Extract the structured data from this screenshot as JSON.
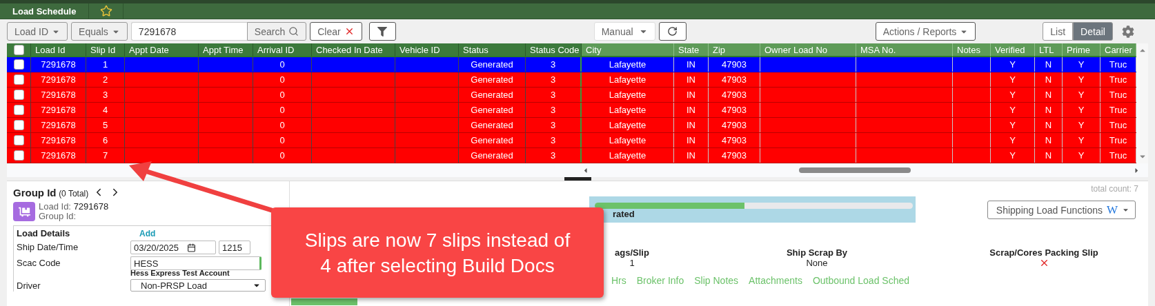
{
  "tabs": [
    {
      "label": "Load Schedule",
      "selected": true
    }
  ],
  "toolbar": {
    "field_dropdown": "Load ID",
    "operator_dropdown": "Equals",
    "search_value": "7291678",
    "search_button": "Search",
    "clear_button": "Clear",
    "mode_dropdown": "Manual",
    "actions_button": "Actions / Reports",
    "view_toggle": [
      {
        "label": "List",
        "selected": false
      },
      {
        "label": "Detail",
        "selected": true
      }
    ]
  },
  "table": {
    "all_checked": false,
    "columns": [
      {
        "label": "Load Id",
        "pinned": true
      },
      {
        "label": "Slip Id",
        "pinned": true
      },
      {
        "label": "Appt Date",
        "pinned": true
      },
      {
        "label": "Appt Time",
        "pinned": true
      },
      {
        "label": "Arrival ID",
        "pinned": true
      },
      {
        "label": "Checked In Date",
        "pinned": true
      },
      {
        "label": "Vehicle ID",
        "pinned": true
      },
      {
        "label": "Status",
        "pinned": true
      },
      {
        "label": "Status Code",
        "pinned": true
      },
      {
        "label": "City",
        "pinned": false
      },
      {
        "label": "State",
        "pinned": false
      },
      {
        "label": "Zip",
        "pinned": false
      },
      {
        "label": "Owner Load No",
        "pinned": false
      },
      {
        "label": "MSA No.",
        "pinned": false
      },
      {
        "label": "Notes",
        "pinned": false
      },
      {
        "label": "Verified",
        "pinned": false
      },
      {
        "label": "LTL",
        "pinned": false
      },
      {
        "label": "Prime",
        "pinned": false
      },
      {
        "label": "Carrier",
        "pinned": false
      }
    ],
    "rows": [
      {
        "selected": true,
        "checked": false,
        "cells": [
          "7291678",
          "1",
          null,
          null,
          "0",
          null,
          null,
          "Generated",
          "3",
          "Lafayette",
          "IN",
          "47903",
          null,
          null,
          null,
          "Y",
          "N",
          "Y",
          "Truc"
        ]
      },
      {
        "selected": false,
        "checked": false,
        "cells": [
          "7291678",
          "2",
          null,
          null,
          "0",
          null,
          null,
          "Generated",
          "3",
          "Lafayette",
          "IN",
          "47903",
          null,
          null,
          null,
          "Y",
          "N",
          "Y",
          "Truc"
        ]
      },
      {
        "selected": false,
        "checked": false,
        "cells": [
          "7291678",
          "3",
          null,
          null,
          "0",
          null,
          null,
          "Generated",
          "3",
          "Lafayette",
          "IN",
          "47903",
          null,
          null,
          null,
          "Y",
          "N",
          "Y",
          "Truc"
        ]
      },
      {
        "selected": false,
        "checked": false,
        "cells": [
          "7291678",
          "4",
          null,
          null,
          "0",
          null,
          null,
          "Generated",
          "3",
          "Lafayette",
          "IN",
          "47903",
          null,
          null,
          null,
          "Y",
          "N",
          "Y",
          "Truc"
        ]
      },
      {
        "selected": false,
        "checked": false,
        "cells": [
          "7291678",
          "5",
          null,
          null,
          "0",
          null,
          null,
          "Generated",
          "3",
          "Lafayette",
          "IN",
          "47903",
          null,
          null,
          null,
          "Y",
          "N",
          "Y",
          "Truc"
        ]
      },
      {
        "selected": false,
        "checked": false,
        "cells": [
          "7291678",
          "6",
          null,
          null,
          "0",
          null,
          null,
          "Generated",
          "3",
          "Lafayette",
          "IN",
          "47903",
          null,
          null,
          null,
          "Y",
          "N",
          "Y",
          "Truc"
        ]
      },
      {
        "selected": false,
        "checked": false,
        "cells": [
          "7291678",
          "7",
          null,
          null,
          "0",
          null,
          null,
          "Generated",
          "3",
          "Lafayette",
          "IN",
          "47903",
          null,
          null,
          null,
          "Y",
          "N",
          "Y",
          "Truc"
        ]
      }
    ]
  },
  "total_count": "total count: 7",
  "group": {
    "title": "Group Id",
    "count": "(0 Total)",
    "load_id_label": "Load Id:",
    "load_id": "7291678",
    "group_id_label": "Group Id:"
  },
  "load_details": {
    "title": "Load Details",
    "add_link": "Add",
    "ship_date_label": "Ship Date/Time",
    "ship_date": "03/20/2025",
    "ship_time": "1215",
    "scac_label": "Scac Code",
    "scac_value": "HESS",
    "scac_name": "Hess Express Test Account",
    "driver_label": "Driver",
    "driver_value": "Non-PRSP Load"
  },
  "status": {
    "label": "rated",
    "level": 0.47
  },
  "shipping_functions": {
    "label": "Shipping Load Functions",
    "glyph": "W"
  },
  "summary": [
    {
      "kind": "text",
      "label": "ags/Slip",
      "value": "1"
    },
    {
      "kind": "text",
      "label": "Ship Scrap By",
      "value": "None"
    },
    {
      "kind": "flag",
      "label": "Scrap/Cores Packing Slip",
      "checked": false
    }
  ],
  "links": [
    "Hrs",
    "Broker Info",
    "Slip Notes",
    "Attachments",
    "Outbound Load Sched"
  ],
  "callout": "Slips are now 7 slips instead of 4 after selecting Build Docs"
}
